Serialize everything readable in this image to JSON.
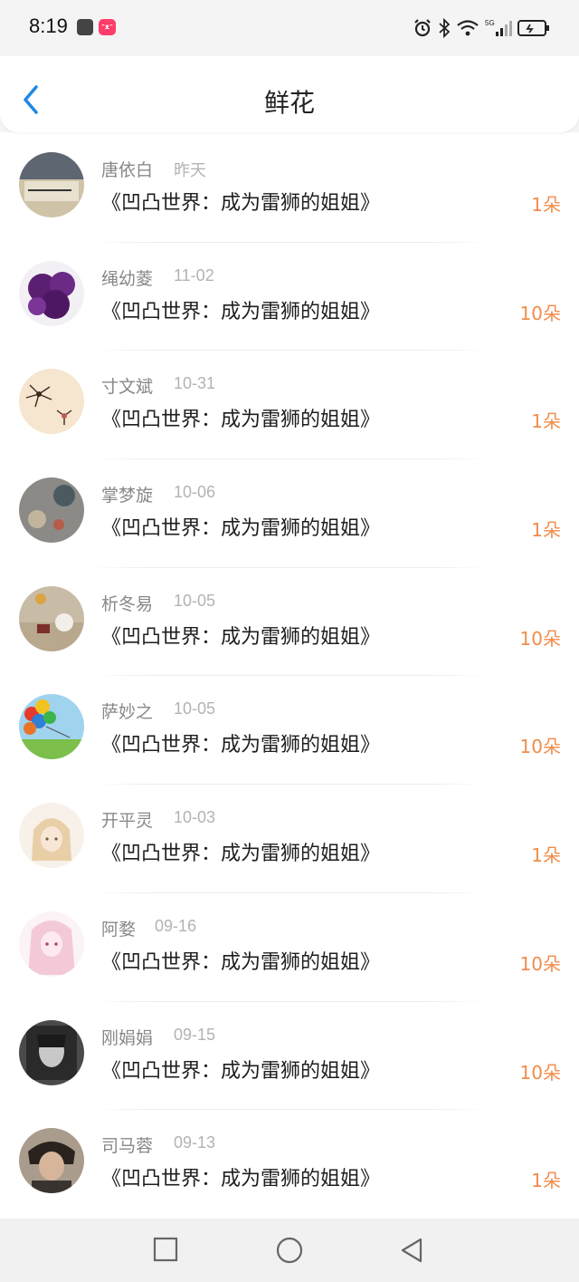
{
  "status_bar": {
    "time": "8:19",
    "app_badge": "ᵔᴥᵔ",
    "network": "5G"
  },
  "header": {
    "title": "鲜花"
  },
  "colors": {
    "accent": "#1e88e5",
    "count": "#f08c4a"
  },
  "items": [
    {
      "name": "唐依白",
      "date": "昨天",
      "book": "《凹凸世界：成为雷狮的姐姐》",
      "count": "1朵"
    },
    {
      "name": "绳幼菱",
      "date": "11-02",
      "book": "《凹凸世界：成为雷狮的姐姐》",
      "count": "10朵"
    },
    {
      "name": "寸文斌",
      "date": "10-31",
      "book": "《凹凸世界：成为雷狮的姐姐》",
      "count": "1朵"
    },
    {
      "name": "掌梦旋",
      "date": "10-06",
      "book": "《凹凸世界：成为雷狮的姐姐》",
      "count": "1朵"
    },
    {
      "name": "析冬易",
      "date": "10-05",
      "book": "《凹凸世界：成为雷狮的姐姐》",
      "count": "10朵"
    },
    {
      "name": "萨妙之",
      "date": "10-05",
      "book": "《凹凸世界：成为雷狮的姐姐》",
      "count": "10朵"
    },
    {
      "name": "开平灵",
      "date": "10-03",
      "book": "《凹凸世界：成为雷狮的姐姐》",
      "count": "1朵"
    },
    {
      "name": "阿婺",
      "date": "09-16",
      "book": "《凹凸世界：成为雷狮的姐姐》",
      "count": "10朵"
    },
    {
      "name": "刚娟娟",
      "date": "09-15",
      "book": "《凹凸世界：成为雷狮的姐姐》",
      "count": "10朵"
    },
    {
      "name": "司马蓉",
      "date": "09-13",
      "book": "《凹凸世界：成为雷狮的姐姐》",
      "count": "1朵"
    }
  ],
  "nav": {
    "icons": [
      "square-recents-icon",
      "circle-home-icon",
      "triangle-back-icon"
    ]
  }
}
